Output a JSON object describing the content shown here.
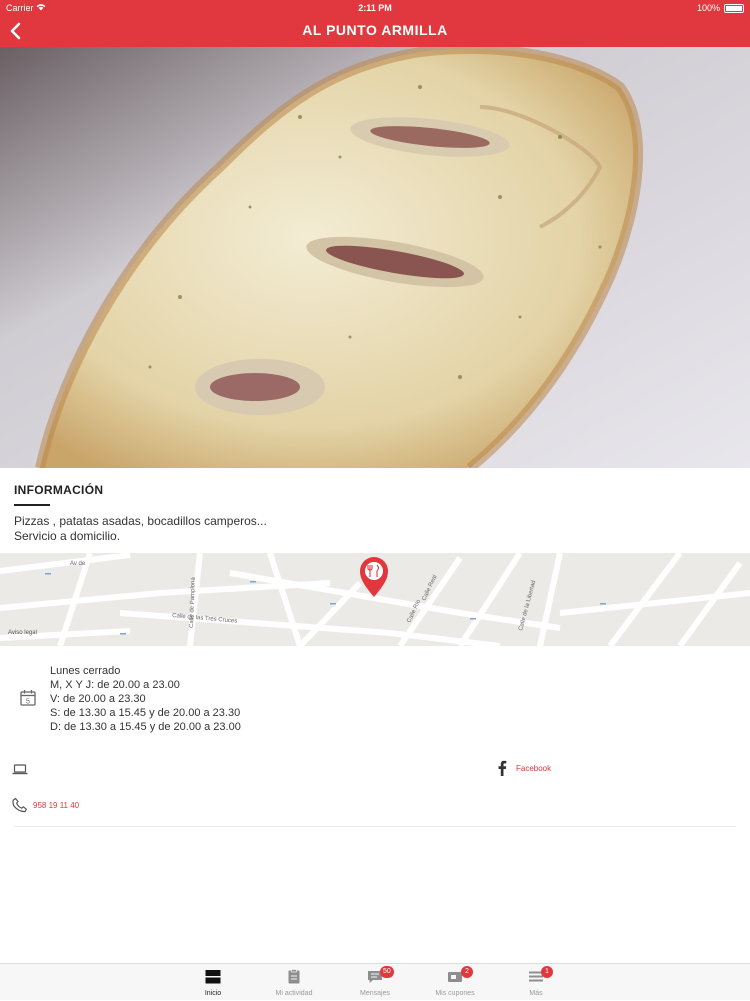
{
  "status_bar": {
    "carrier": "Carrier",
    "time": "2:11 PM",
    "battery": "100%"
  },
  "nav": {
    "title": "AL PUNTO ARMILLA"
  },
  "info": {
    "title": "INFORMACIÓN",
    "description": [
      "Pizzas , patatas asadas, bocadillos camperos...",
      "Servicio a domicilio."
    ]
  },
  "map": {
    "legal_label": "Aviso legal",
    "street_labels": [
      "Av de",
      "Calle de Pamplona",
      "Calle de las Tres Cruces",
      "Calle Río",
      "Calle Real",
      "Calle de la Libertad"
    ]
  },
  "hours": {
    "lines": [
      "Lunes cerrado",
      "M, X Y J: de 20.00 a 23.00",
      "V: de 20.00 a 23.30",
      "S: de 13.30 a 15.45 y de 20.00 a 23.30",
      "D: de 13.30 a 15.45 y de 20.00 a 23.00"
    ]
  },
  "contact": {
    "facebook_label": "Facebook",
    "phone": "958 19 11 40"
  },
  "tabs": [
    {
      "label": "Inicio",
      "icon": "home-icon",
      "badge": "",
      "active": true
    },
    {
      "label": "Mi actividad",
      "icon": "clipboard-icon",
      "badge": "",
      "active": false
    },
    {
      "label": "Mensajes",
      "icon": "messages-icon",
      "badge": "50",
      "active": false
    },
    {
      "label": "Mis cupones",
      "icon": "coupons-icon",
      "badge": "2",
      "active": false
    },
    {
      "label": "Más",
      "icon": "menu-icon",
      "badge": "1",
      "active": false
    }
  ],
  "colors": {
    "accent": "#e0383e",
    "map_background": "#eceae6",
    "tab_inactive": "#9a9a9a"
  }
}
